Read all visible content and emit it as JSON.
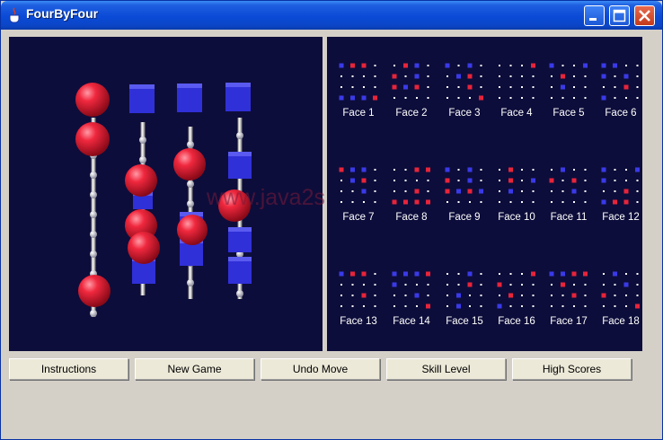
{
  "window": {
    "title": "FourByFour"
  },
  "watermark": "www.java2s.com",
  "buttons": [
    "Instructions",
    "New Game",
    "Undo Move",
    "Skill Level",
    "High Scores"
  ],
  "colors": {
    "player": "#e8243a",
    "computer": "#3a3ae8",
    "empty": "#ffffff",
    "board_bg": "#0d0d3b"
  },
  "faces": [
    {
      "label": "Face 1",
      "grid": [
        "BRR.",
        "....",
        "....",
        "BBBR"
      ]
    },
    {
      "label": "Face 2",
      "grid": [
        ".RB.",
        "R.B.",
        "RBR.",
        "...."
      ]
    },
    {
      "label": "Face 3",
      "grid": [
        "B.B.",
        ".BR.",
        "..R.",
        "...R"
      ]
    },
    {
      "label": "Face 4",
      "grid": [
        "...R",
        "....",
        "....",
        "...."
      ]
    },
    {
      "label": "Face 5",
      "grid": [
        "B..B",
        ".R..",
        ".B..",
        "...."
      ]
    },
    {
      "label": "Face 6",
      "grid": [
        "BB..",
        "B.B.",
        "..R.",
        "B..."
      ]
    },
    {
      "label": "Face 7",
      "grid": [
        "RBB.",
        ".BR.",
        "..B.",
        "...."
      ]
    },
    {
      "label": "Face 8",
      "grid": [
        "..RR",
        "....",
        "..R.",
        "RRRR"
      ]
    },
    {
      "label": "Face 9",
      "grid": [
        "B.B.",
        "R.B.",
        "RBRB",
        "...."
      ]
    },
    {
      "label": "Face 10",
      "grid": [
        ".R..",
        ".R.B",
        ".B..",
        "...."
      ]
    },
    {
      "label": "Face 11",
      "grid": [
        ".B..",
        "R.R.",
        "..B.",
        "...."
      ]
    },
    {
      "label": "Face 12",
      "grid": [
        "B..B",
        "B...",
        "..R.",
        "BRR."
      ]
    },
    {
      "label": "Face 13",
      "grid": [
        "BRR.",
        "....",
        "..R.",
        "...."
      ]
    },
    {
      "label": "Face 14",
      "grid": [
        "BBBR",
        "B...",
        "..B.",
        "...R"
      ]
    },
    {
      "label": "Face 15",
      "grid": [
        "..B.",
        "..R.",
        ".B..",
        ".B.."
      ]
    },
    {
      "label": "Face 16",
      "grid": [
        "...R",
        "R...",
        ".R..",
        "B..."
      ]
    },
    {
      "label": "Face 17",
      "grid": [
        "BBRR",
        ".R..",
        "..R.",
        "...."
      ]
    },
    {
      "label": "Face 18",
      "grid": [
        ".B..",
        "..B.",
        "R...",
        "...R"
      ]
    }
  ]
}
